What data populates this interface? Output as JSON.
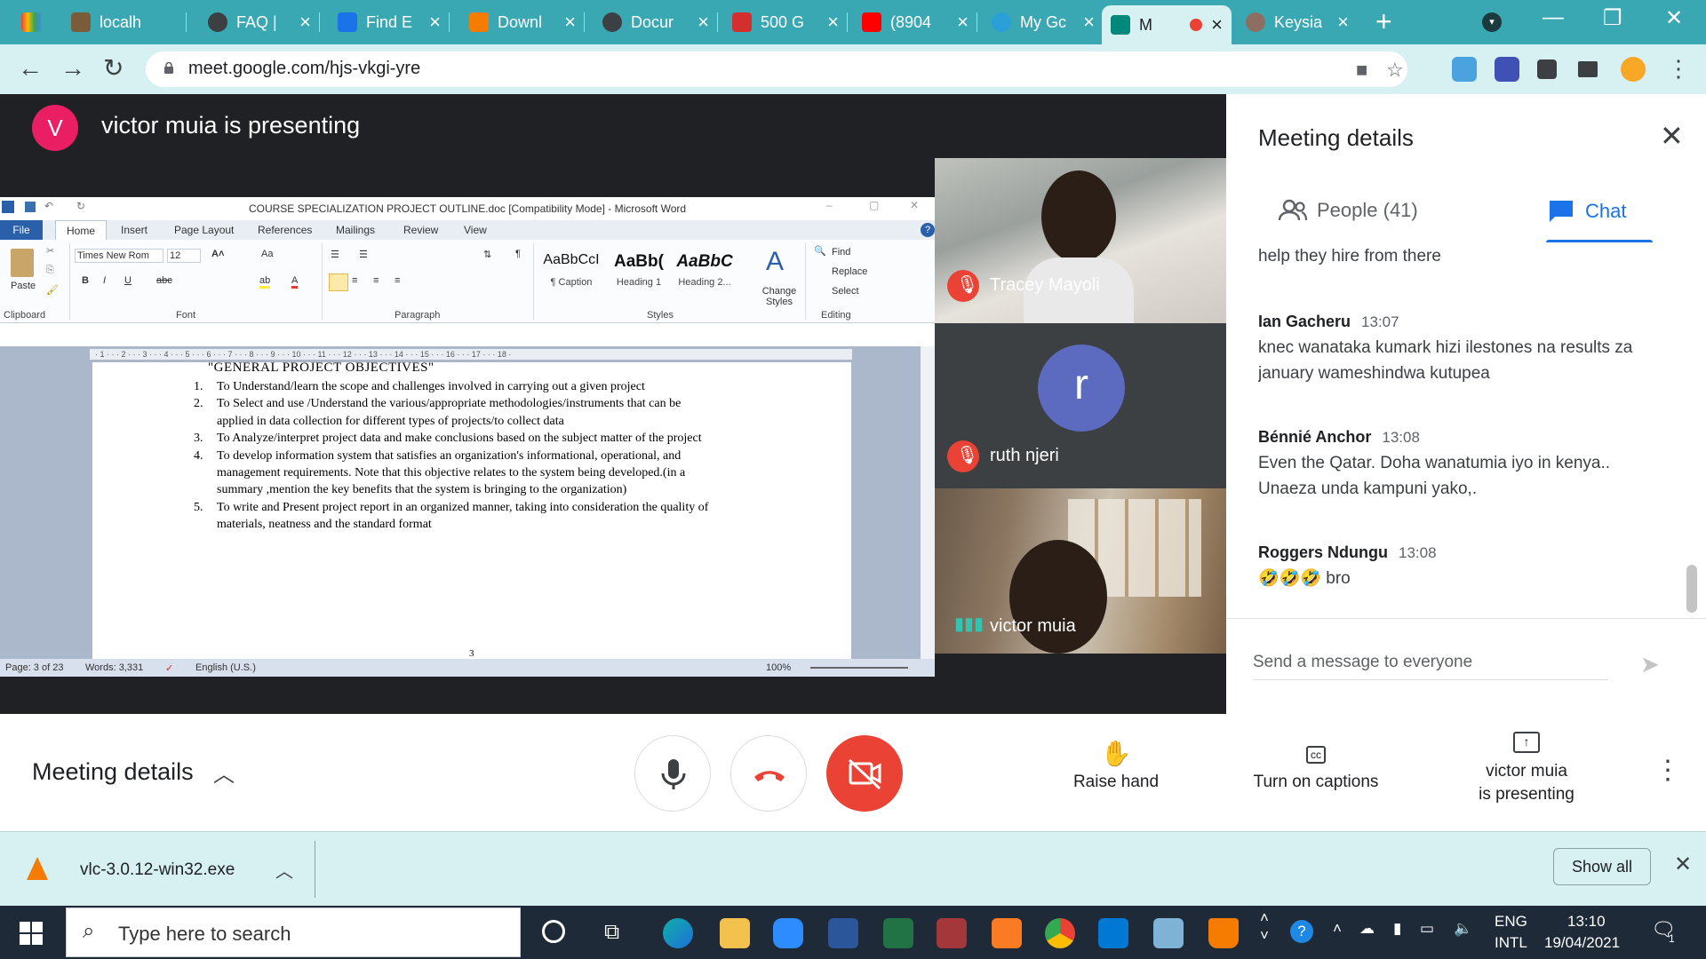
{
  "browser": {
    "tabs": [
      {
        "label": "",
        "color": "#f4b400"
      },
      {
        "label": "localh",
        "color": "#7a5b3a"
      },
      {
        "label": "FAQ | ",
        "color": "#3c4043"
      },
      {
        "label": "Find E",
        "color": "#1a73e8"
      },
      {
        "label": "Downl",
        "color": "#f57c00"
      },
      {
        "label": "Docur",
        "color": "#3c4043"
      },
      {
        "label": "500 G",
        "color": "#d32f2f"
      },
      {
        "label": "(8904",
        "color": "#ff0000"
      },
      {
        "label": "My Gc",
        "color": "#2a9fd8"
      },
      {
        "label": "M",
        "color": "#00897b"
      },
      {
        "label": "Keysia",
        "color": "#8d6e63"
      }
    ],
    "new_tab": "+",
    "url": "meet.google.com/hjs-vkgi-yre"
  },
  "meet": {
    "presenter_initial": "V",
    "presenter_text": "victor muia is presenting",
    "participants": [
      {
        "name": "Tracey Mayoli",
        "muted": true
      },
      {
        "name": "ruth njeri",
        "muted": true,
        "initial": "r"
      },
      {
        "name": "victor muia",
        "muted": false
      }
    ]
  },
  "word": {
    "title": "COURSE SPECIALIZATION PROJECT OUTLINE.doc [Compatibility Mode] - Microsoft Word",
    "tabs": [
      "File",
      "Home",
      "Insert",
      "Page Layout",
      "References",
      "Mailings",
      "Review",
      "View"
    ],
    "font_name": "Times New Rom",
    "font_size": "12",
    "groups": [
      "Clipboard",
      "Font",
      "Paragraph",
      "Styles",
      "Editing"
    ],
    "paste_label": "Paste",
    "styles": [
      {
        "sample": "AaBbCcI",
        "name": "¶ Caption"
      },
      {
        "sample": "AaBb(",
        "name": "Heading 1"
      },
      {
        "sample": "AaBbC",
        "name": "Heading 2..."
      }
    ],
    "change_styles": "Change Styles",
    "editing": [
      "Find",
      "Replace",
      "Select"
    ],
    "doc_heading": "\"GENERAL PROJECT OBJECTIVES\"",
    "objectives": [
      {
        "num": "1.",
        "text": "To Understand/learn the scope and challenges involved in carrying out a given project"
      },
      {
        "num": "2.",
        "text": "To Select and use /Understand the various/appropriate methodologies/instruments that can be applied in data collection for different types of projects/to collect data"
      },
      {
        "num": "3.",
        "text": "To Analyze/interpret project data and make conclusions based on the subject matter of the project"
      },
      {
        "num": "4.",
        "text": "To develop information system that satisfies an organization's informational, operational, and management requirements. Note that this objective relates to the system being developed.(in a summary ,mention the key benefits that the system is bringing to the organization)"
      },
      {
        "num": "5.",
        "text": "To write and Present project report in an organized manner, taking into consideration the quality of materials, neatness and the standard format"
      }
    ],
    "page_number": "3",
    "status": {
      "page": "Page: 3 of 23",
      "words": "Words: 3,331",
      "language": "English (U.S.)",
      "zoom": "100%"
    }
  },
  "panel": {
    "title": "Meeting details",
    "people_label": "People (41)",
    "chat_label": "Chat",
    "messages": [
      {
        "sender": "",
        "time": "",
        "text": "help they hire from there"
      },
      {
        "sender": "Ian Gacheru",
        "time": "13:07",
        "text": "knec wanataka kumark hizi ilestones na results za january wameshindwa kutupea"
      },
      {
        "sender": "Bénnié Anchor",
        "time": "13:08",
        "text": "Even the Qatar. Doha wanatumia iyo in kenya.. Unaeza unda kampuni yako,."
      },
      {
        "sender": "Roggers Ndungu",
        "time": "13:08",
        "text": "🤣🤣🤣 bro"
      }
    ],
    "send_placeholder": "Send a message to everyone"
  },
  "controls": {
    "meeting_details": "Meeting details",
    "raise_hand": "Raise hand",
    "captions": "Turn on captions",
    "presenting_line1": "victor muia",
    "presenting_line2": "is presenting"
  },
  "download": {
    "file": "vlc-3.0.12-win32.exe",
    "show_all": "Show all"
  },
  "taskbar": {
    "search_placeholder": "Type here to search",
    "lang_line1": "ENG",
    "lang_line2": "INTL",
    "time": "13:10",
    "date": "19/04/2021",
    "notifications": "1"
  },
  "colors": {
    "chrome_teal": "#3aa8b3",
    "meet_red": "#ea4335",
    "chat_blue": "#1a73e8",
    "presenter_pink": "#e91e63"
  }
}
